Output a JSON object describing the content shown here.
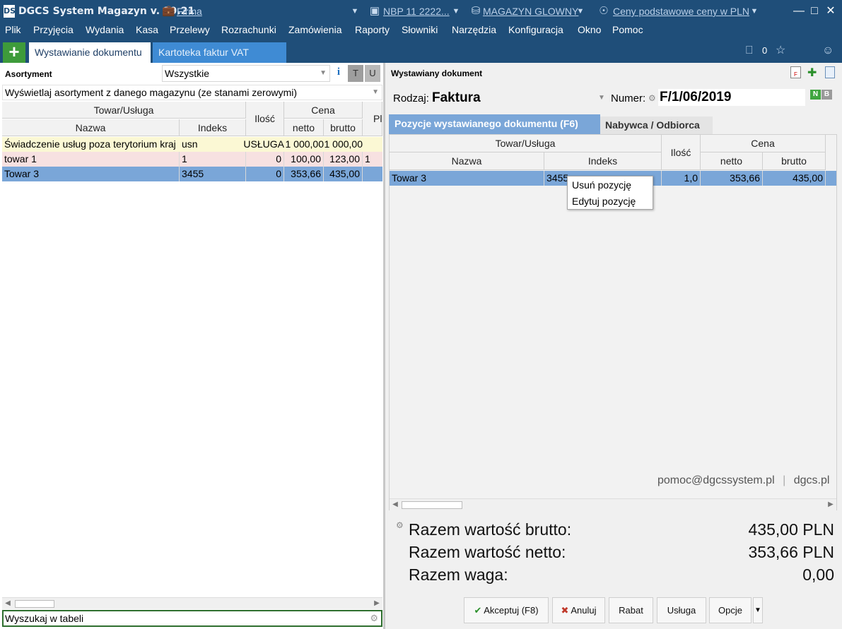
{
  "title_bar": {
    "logo": "DS",
    "app_title": "DGCS System Magazyn v. 19.21",
    "firma_link": "Firma",
    "nbp_link": "NBP 11 2222...",
    "warehouse_link": "MAGAZYN GLOWNY",
    "prices_link": "Ceny podstawowe ceny w PLN"
  },
  "menu": [
    "Plik",
    "Przyjęcia",
    "Wydania",
    "Kasa",
    "Przelewy",
    "Rozrachunki",
    "Zamówienia",
    "Raporty",
    "Słowniki",
    "Narzędzia",
    "Konfiguracja",
    "Okno",
    "Pomoc"
  ],
  "tabs": {
    "active": "Wystawianie dokumentu",
    "inactive": "Kartoteka faktur VAT",
    "counter": "0"
  },
  "left": {
    "header": "Asortyment",
    "filter_value": "Wszystkie",
    "btn_i": "i",
    "btn_t": "T",
    "btn_u": "U",
    "mode_value": "Wyświetlaj asortyment z danego magazynu (ze stanami zerowymi)",
    "columns": {
      "group_tow": "Towar/Usługa",
      "nazwa": "Nazwa",
      "indeks": "Indeks",
      "ilosc": "Ilość",
      "group_cena": "Cena",
      "netto": "netto",
      "brutto": "brutto",
      "extra": "Pl"
    },
    "rows": [
      {
        "nazwa": "Świadczenie usług poza terytorium kraj",
        "indeks": "usn",
        "ilosc": "USŁUGA",
        "netto": "1 000,00",
        "brutto": "1 000,00",
        "extra": ""
      },
      {
        "nazwa": "towar 1",
        "indeks": "1",
        "ilosc": "0",
        "netto": "100,00",
        "brutto": "123,00",
        "extra": "1"
      },
      {
        "nazwa": "Towar 3",
        "indeks": "3455",
        "ilosc": "0",
        "netto": "353,66",
        "brutto": "435,00",
        "extra": ""
      }
    ],
    "search_placeholder": "Wyszukaj w tabeli"
  },
  "right": {
    "header": "Wystawiany dokument",
    "rodzaj_label": "Rodzaj:",
    "rodzaj_value": "Faktura",
    "numer_label": "Numer:",
    "numer_value": "F/1/06/2019",
    "badge_n": "N",
    "badge_b": "B",
    "subtabs": {
      "active": "Pozycje wystawianego dokumentu (F6)",
      "inactive": "Nabywca / Odbiorca"
    },
    "columns": {
      "group_tow": "Towar/Usługa",
      "nazwa": "Nazwa",
      "indeks": "Indeks",
      "ilosc": "Ilość",
      "group_cena": "Cena",
      "netto": "netto",
      "brutto": "brutto"
    },
    "rows": [
      {
        "nazwa": "Towar 3",
        "indeks": "3455",
        "ilosc": "1,0",
        "netto": "353,66",
        "brutto": "435,00"
      }
    ],
    "context_menu": [
      "Usuń pozycję",
      "Edytuj pozycję"
    ],
    "contact_email": "pomoc@dgcssystem.pl",
    "contact_sep": "|",
    "contact_site": "dgcs.pl",
    "totals": [
      {
        "label": "Razem wartość brutto:",
        "value": "435,00 PLN"
      },
      {
        "label": "Razem wartość netto:",
        "value": "353,66 PLN"
      },
      {
        "label": "Razem waga:",
        "value": "0,00"
      }
    ],
    "buttons": {
      "accept": "Akceptuj (F8)",
      "cancel": "Anuluj",
      "discount": "Rabat",
      "service": "Usługa",
      "options": "Opcje"
    }
  },
  "colors": {
    "title_bg": "#1f4e79",
    "selected_row": "#7aa6d8",
    "row_yellow": "#fbf8d4",
    "row_pink": "#f7e1e1",
    "add_green": "#3e9b3b"
  }
}
